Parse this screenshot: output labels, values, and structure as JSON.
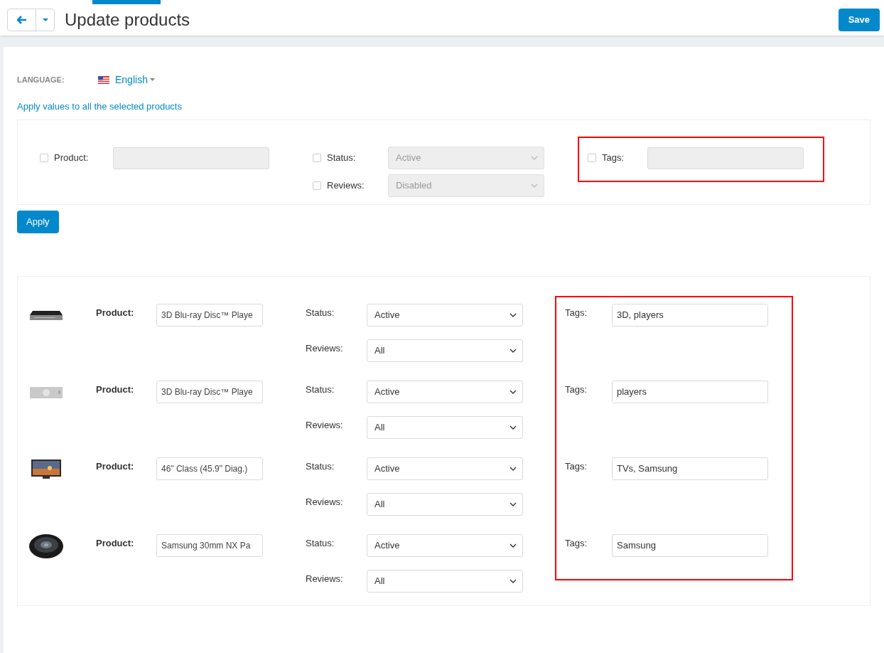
{
  "header": {
    "title": "Update products",
    "save": "Save"
  },
  "language": {
    "label": "LANGUAGE:",
    "value": "English"
  },
  "apply_link": "Apply values to all the selected products",
  "bulk": {
    "fields": [
      {
        "kind": "text",
        "label": "Product:",
        "checked": false
      },
      {
        "kind": "select",
        "label": "Status:",
        "value": "Active",
        "checked": false
      },
      {
        "kind": "select",
        "label": "Reviews:",
        "value": "Disabled",
        "checked": false
      },
      {
        "kind": "text",
        "label": "Tags:",
        "checked": false
      }
    ],
    "apply": "Apply"
  },
  "products": [
    {
      "product_label": "Product:",
      "name": "3D Blu-ray Disc™ Playe",
      "status_label": "Status:",
      "status": "Active",
      "reviews_label": "Reviews:",
      "reviews": "All",
      "tags_label": "Tags:",
      "tags": "3D, players"
    },
    {
      "product_label": "Product:",
      "name": "3D Blu-ray Disc™ Playe",
      "status_label": "Status:",
      "status": "Active",
      "reviews_label": "Reviews:",
      "reviews": "All",
      "tags_label": "Tags:",
      "tags": "players"
    },
    {
      "product_label": "Product:",
      "name": "46\" Class (45.9\" Diag.)",
      "status_label": "Status:",
      "status": "Active",
      "reviews_label": "Reviews:",
      "reviews": "All",
      "tags_label": "Tags:",
      "tags": "TVs, Samsung"
    },
    {
      "product_label": "Product:",
      "name": "Samsung 30mm NX Pa",
      "status_label": "Status:",
      "status": "Active",
      "reviews_label": "Reviews:",
      "reviews": "All",
      "tags_label": "Tags:",
      "tags": "Samsung"
    }
  ]
}
